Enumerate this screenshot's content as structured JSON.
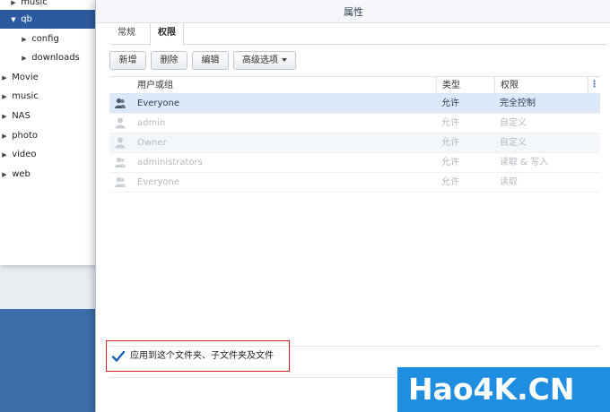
{
  "tree": {
    "items": [
      {
        "label": "music",
        "expanded": false,
        "indent": 1,
        "partial": true
      },
      {
        "label": "qb",
        "expanded": true,
        "indent": 1,
        "selected": true
      },
      {
        "label": "config",
        "expanded": false,
        "indent": 2
      },
      {
        "label": "downloads",
        "expanded": false,
        "indent": 2
      },
      {
        "label": "Movie",
        "expanded": false,
        "indent": 0
      },
      {
        "label": "music",
        "expanded": false,
        "indent": 0
      },
      {
        "label": "NAS",
        "expanded": false,
        "indent": 0
      },
      {
        "label": "photo",
        "expanded": false,
        "indent": 0
      },
      {
        "label": "video",
        "expanded": false,
        "indent": 0
      },
      {
        "label": "web",
        "expanded": false,
        "indent": 0
      }
    ]
  },
  "dialog": {
    "title": "属性",
    "tabs": [
      {
        "label": "常规",
        "active": false
      },
      {
        "label": "权限",
        "active": true
      }
    ],
    "toolbar": {
      "create": "新增",
      "delete": "删除",
      "edit": "编辑",
      "advanced": "高级选项"
    },
    "table": {
      "columns": [
        "用户或组",
        "类型",
        "权限"
      ],
      "rows": [
        {
          "name": "Everyone",
          "type": "允许",
          "permission": "完全控制",
          "selected": true,
          "icon": "group-icon"
        },
        {
          "name": "admin",
          "type": "允许",
          "permission": "自定义",
          "selected": false,
          "icon": "user-icon"
        },
        {
          "name": "Owner",
          "type": "允许",
          "permission": "自定义",
          "selected": false,
          "icon": "user-icon"
        },
        {
          "name": "administrators",
          "type": "允许",
          "permission": "读取 & 写入",
          "selected": false,
          "icon": "group-icon"
        },
        {
          "name": "Everyone",
          "type": "允许",
          "permission": "读取",
          "selected": false,
          "icon": "group-icon"
        }
      ]
    },
    "apply_checkbox": {
      "label": "应用到这个文件夹、子文件夹及文件",
      "checked": true
    }
  },
  "watermark": "Hao4K.CN",
  "colors": {
    "selection": "#2c5aa0",
    "row_selected": "#dbe9f8",
    "accent": "#2a5ea8",
    "highlight": "#e02020",
    "watermark_bg": "#1f8de0"
  }
}
